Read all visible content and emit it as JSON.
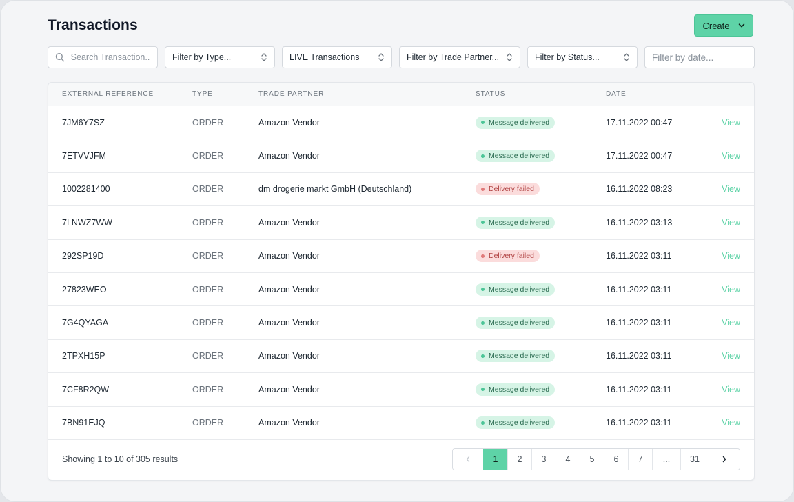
{
  "header": {
    "title": "Transactions",
    "create_label": "Create"
  },
  "filters": {
    "search_placeholder": "Search Transaction...",
    "type": "Filter by Type...",
    "environment": "LIVE Transactions",
    "trade_partner": "Filter by Trade Partner...",
    "status": "Filter by Status...",
    "date_placeholder": "Filter by date..."
  },
  "table": {
    "columns": [
      "EXTERNAL REFERENCE",
      "TYPE",
      "TRADE PARTNER",
      "STATUS",
      "DATE"
    ],
    "view_label": "View",
    "rows": [
      {
        "ref": "7JM6Y7SZ",
        "type": "ORDER",
        "partner": "Amazon Vendor",
        "status": "Message delivered",
        "status_kind": "ok",
        "date": "17.11.2022 00:47"
      },
      {
        "ref": "7ETVVJFM",
        "type": "ORDER",
        "partner": "Amazon Vendor",
        "status": "Message delivered",
        "status_kind": "ok",
        "date": "17.11.2022 00:47"
      },
      {
        "ref": "1002281400",
        "type": "ORDER",
        "partner": "dm drogerie markt GmbH (Deutschland)",
        "status": "Delivery failed",
        "status_kind": "fail",
        "date": "16.11.2022 08:23"
      },
      {
        "ref": "7LNWZ7WW",
        "type": "ORDER",
        "partner": "Amazon Vendor",
        "status": "Message delivered",
        "status_kind": "ok",
        "date": "16.11.2022 03:13"
      },
      {
        "ref": "292SP19D",
        "type": "ORDER",
        "partner": "Amazon Vendor",
        "status": "Delivery failed",
        "status_kind": "fail",
        "date": "16.11.2022 03:11"
      },
      {
        "ref": "27823WEO",
        "type": "ORDER",
        "partner": "Amazon Vendor",
        "status": "Message delivered",
        "status_kind": "ok",
        "date": "16.11.2022 03:11"
      },
      {
        "ref": "7G4QYAGA",
        "type": "ORDER",
        "partner": "Amazon Vendor",
        "status": "Message delivered",
        "status_kind": "ok",
        "date": "16.11.2022 03:11"
      },
      {
        "ref": "2TPXH15P",
        "type": "ORDER",
        "partner": "Amazon Vendor",
        "status": "Message delivered",
        "status_kind": "ok",
        "date": "16.11.2022 03:11"
      },
      {
        "ref": "7CF8R2QW",
        "type": "ORDER",
        "partner": "Amazon Vendor",
        "status": "Message delivered",
        "status_kind": "ok",
        "date": "16.11.2022 03:11"
      },
      {
        "ref": "7BN91EJQ",
        "type": "ORDER",
        "partner": "Amazon Vendor",
        "status": "Message delivered",
        "status_kind": "ok",
        "date": "16.11.2022 03:11"
      }
    ]
  },
  "footer": {
    "results_text": "Showing 1 to 10 of 305 results",
    "pages": [
      "1",
      "2",
      "3",
      "4",
      "5",
      "6",
      "7",
      "...",
      "31"
    ],
    "active_page": "1"
  },
  "icons": {
    "search": "search-icon",
    "dropdown": "chevron-down-icon",
    "select": "updown-arrows-icon",
    "prev": "chevron-left-icon",
    "next": "chevron-right-icon"
  },
  "colors": {
    "accent": "#5ed3a7",
    "ok_bg": "#d6f4e6",
    "fail_bg": "#fbdcdc"
  }
}
